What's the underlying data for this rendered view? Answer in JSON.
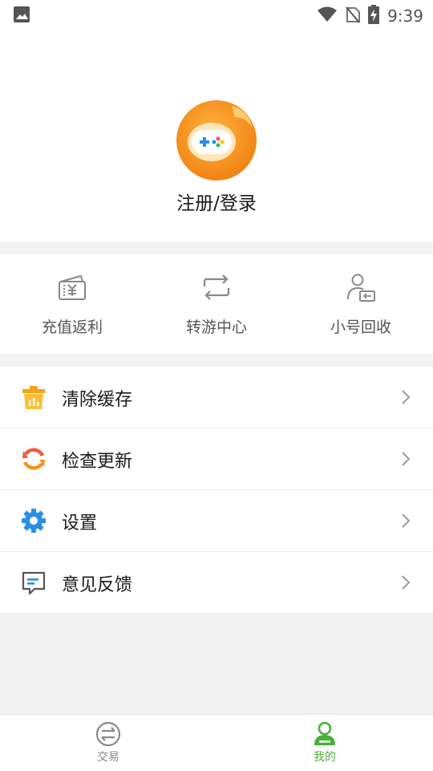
{
  "status_bar": {
    "time": "9:39",
    "icons": [
      "gallery-icon",
      "wifi-icon",
      "no-sim-icon",
      "battery-charging-icon"
    ]
  },
  "profile": {
    "login_label": "注册/登录",
    "avatar_icon": "gamepad-logo-icon"
  },
  "quick_actions": [
    {
      "label": "充值返利",
      "icon": "recharge-rebate-icon"
    },
    {
      "label": "转游中心",
      "icon": "transfer-game-icon"
    },
    {
      "label": "小号回收",
      "icon": "account-recycle-icon"
    }
  ],
  "menu": [
    {
      "label": "清除缓存",
      "icon": "clear-cache-icon"
    },
    {
      "label": "检查更新",
      "icon": "check-update-icon"
    },
    {
      "label": "设置",
      "icon": "settings-gear-icon"
    },
    {
      "label": "意见反馈",
      "icon": "feedback-icon"
    }
  ],
  "tabbar": {
    "trade_label": "交易",
    "mine_label": "我的",
    "active": "mine"
  },
  "colors": {
    "accent_green": "#4cae3c",
    "orange": "#f7931e",
    "blue": "#2a8ee8"
  }
}
